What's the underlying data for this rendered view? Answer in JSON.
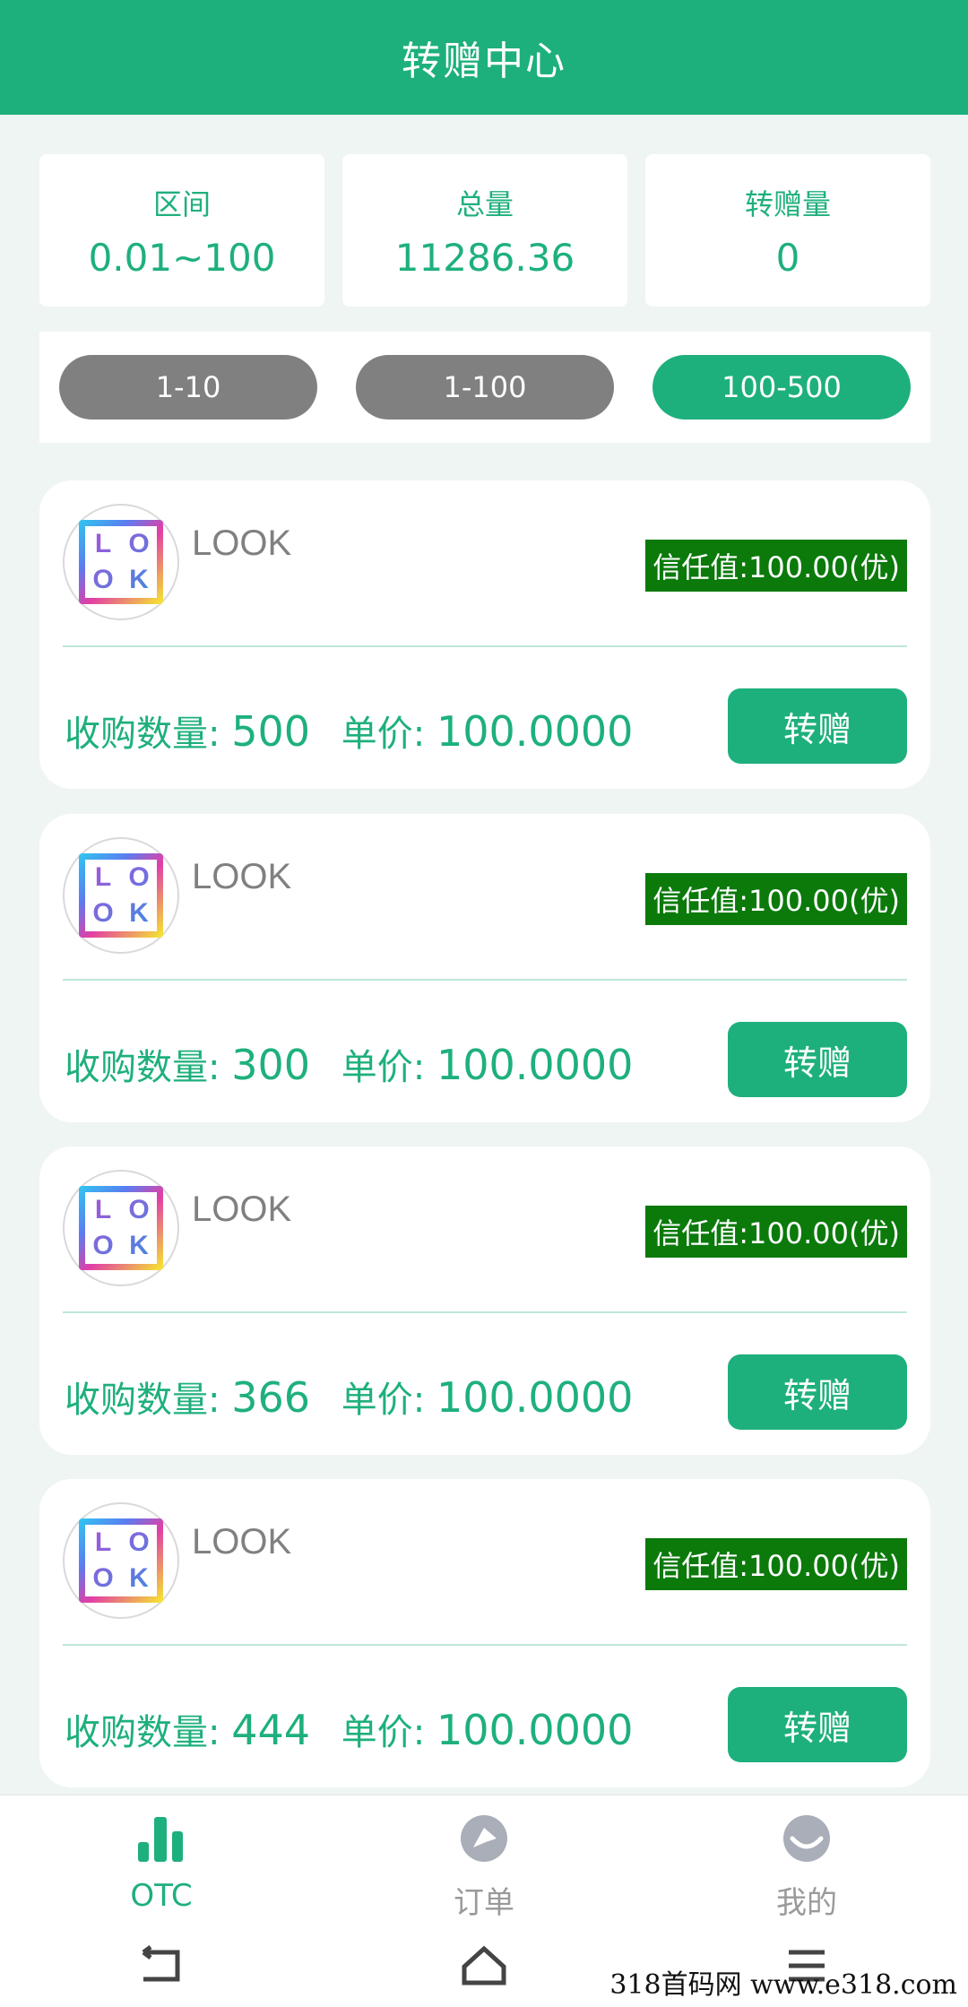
{
  "header": {
    "title": "转赠中心"
  },
  "stats": [
    {
      "label": "区间",
      "value": "0.01~100"
    },
    {
      "label": "总量",
      "value": "11286.36"
    },
    {
      "label": "转赠量",
      "value": "0"
    }
  ],
  "filters": [
    {
      "label": "1-10",
      "active": false
    },
    {
      "label": "1-100",
      "active": false
    },
    {
      "label": "100-500",
      "active": true
    }
  ],
  "orders": [
    {
      "logo_text": "LOOK",
      "name": "LOOK",
      "trust": "信任值:100.00(优)",
      "qty_label": "收购数量:",
      "qty": "500",
      "price_label": "单价:",
      "price": "100.0000",
      "action": "转赠"
    },
    {
      "logo_text": "LOOK",
      "name": "LOOK",
      "trust": "信任值:100.00(优)",
      "qty_label": "收购数量:",
      "qty": "300",
      "price_label": "单价:",
      "price": "100.0000",
      "action": "转赠"
    },
    {
      "logo_text": "LOOK",
      "name": "LOOK",
      "trust": "信任值:100.00(优)",
      "qty_label": "收购数量:",
      "qty": "366",
      "price_label": "单价:",
      "price": "100.0000",
      "action": "转赠"
    },
    {
      "logo_text": "LOOK",
      "name": "LOOK",
      "trust": "信任值:100.00(优)",
      "qty_label": "收购数量:",
      "qty": "444",
      "price_label": "单价:",
      "price": "100.0000",
      "action": "转赠"
    }
  ],
  "tabbar": [
    {
      "label": "OTC",
      "icon": "bar-chart-icon",
      "active": true
    },
    {
      "label": "订单",
      "icon": "order-icon",
      "active": false
    },
    {
      "label": "我的",
      "icon": "profile-icon",
      "active": false
    }
  ],
  "watermark": "318首码网 www.e318.com",
  "colors": {
    "accent": "#1eb07c",
    "trust_badge": "#0b7a0b",
    "inactive_pill": "#808080"
  }
}
